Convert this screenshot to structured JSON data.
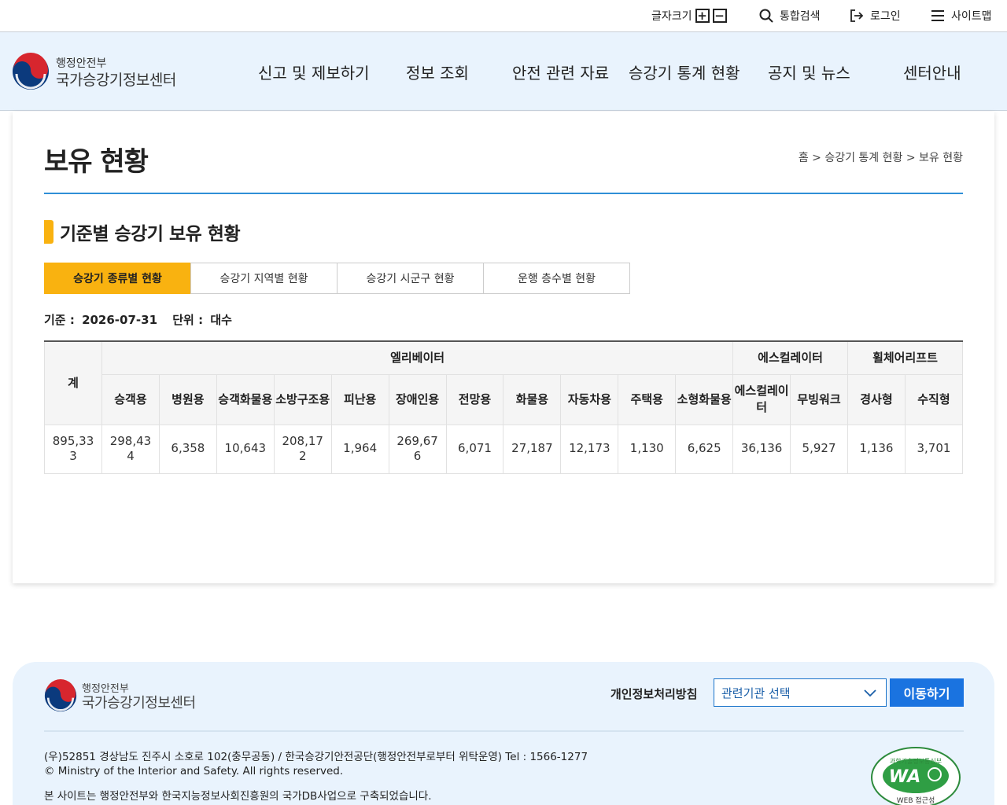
{
  "util": {
    "font_size_label": "글자크기",
    "font_plus": "+",
    "font_minus": "−",
    "search_label": "통합검색",
    "login_label": "로그인",
    "sitemap_label": "사이트맵"
  },
  "header": {
    "logo_line1": "행정안전부",
    "logo_line2": "국가승강기정보센터",
    "nav": [
      "신고 및 제보하기",
      "정보 조회",
      "안전 관련 자료",
      "승강기 통계 현황",
      "공지 및 뉴스",
      "센터안내"
    ]
  },
  "page": {
    "title": "보유 현황",
    "breadcrumb": "홈 > 승강기 통계 현황 > 보유 현황",
    "section_title": "기준별 승강기 보유 현황",
    "tabs": [
      "승강기 종류별 현황",
      "승강기 지역별 현황",
      "승강기 시군구 현황",
      "운행 층수별 현황"
    ],
    "active_tab": 0,
    "basis_label": "기준 :",
    "basis_date": "2026-07-31",
    "unit_label": "단위 :",
    "unit_value": "대수"
  },
  "table": {
    "total_header": "계",
    "groups": [
      "엘리베이터",
      "에스컬레이터",
      "휠체어리프트"
    ],
    "columns": [
      "승객용",
      "병원용",
      "승객화물용",
      "소방구조용",
      "피난용",
      "장애인용",
      "전망용",
      "화물용",
      "자동차용",
      "주택용",
      "소형화물용",
      "에스컬레이터",
      "무빙워크",
      "경사형",
      "수직형"
    ],
    "total": "895,333",
    "values": [
      "298,434",
      "6,358",
      "10,643",
      "208,172",
      "1,964",
      "269,676",
      "6,071",
      "27,187",
      "12,173",
      "1,130",
      "6,625",
      "36,136",
      "5,927",
      "1,136",
      "3,701"
    ]
  },
  "footer": {
    "logo_line1": "행정안전부",
    "logo_line2": "국가승강기정보센터",
    "privacy": "개인정보처리방침",
    "select_label": "관련기관 선택",
    "go_button": "이동하기",
    "address": "(우)52851 경상남도 진주시 소호로 102(충무공동) / 한국승강기안전공단(행정안전부로부터 위탁운영) Tel : 1566-1277",
    "copyright": "© Ministry of the Interior and Safety. All rights reserved.",
    "built_by": "본 사이트는 행정안전부와 한국지능정보사회진흥원의 국가DB사업으로 구축되었습니다.",
    "badge_text": "WA",
    "badge_sub": "WEB 접근성",
    "badge_top": "과학기술정보통신부"
  },
  "colors": {
    "accent_yellow": "#f9b210",
    "accent_blue": "#1a73e0",
    "header_bg": "#e9f3fd"
  }
}
